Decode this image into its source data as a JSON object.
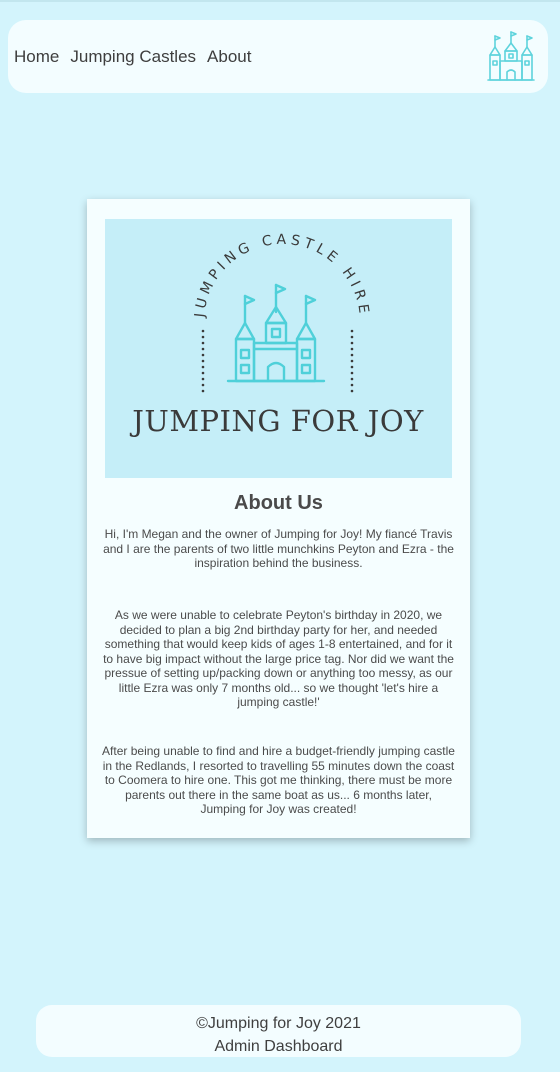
{
  "nav": {
    "links": [
      "Home",
      "Jumping Castles",
      "About"
    ]
  },
  "hero": {
    "arc_text": "JUMPING CASTLE HIRE",
    "brand": "JUMPING FOR JOY"
  },
  "about": {
    "title": "About Us",
    "paragraphs": [
      "Hi, I'm Megan and the owner of Jumping for Joy! My fiancé Travis and I are the parents of two little munchkins Peyton and Ezra - the inspiration behind the business.",
      "As we were unable to celebrate Peyton's birthday in 2020, we decided to plan a big 2nd birthday party for her, and needed something that would keep kids of ages 1-8 entertained, and for it to have big impact without the large price tag. Nor did we want the pressue of setting up/packing down or anything too messy, as our little Ezra was only 7 months old... so we thought 'let's hire a jumping castle!'",
      "After being unable to find and hire a budget-friendly jumping castle in the Redlands, I resorted to travelling 55 minutes down the coast to Coomera to hire one. This got me thinking, there must be more parents out there in the same boat as us... 6 months later, Jumping for Joy was created!"
    ]
  },
  "footer": {
    "copyright": "©Jumping for Joy 2021",
    "admin_link": "Admin Dashboard"
  },
  "colors": {
    "background": "#d3f4fc",
    "accent": "#4fd0d9",
    "hero_bg": "#c5eef8"
  },
  "icons": {
    "nav_logo": "castle-icon",
    "hero_logo": "castle-icon"
  }
}
